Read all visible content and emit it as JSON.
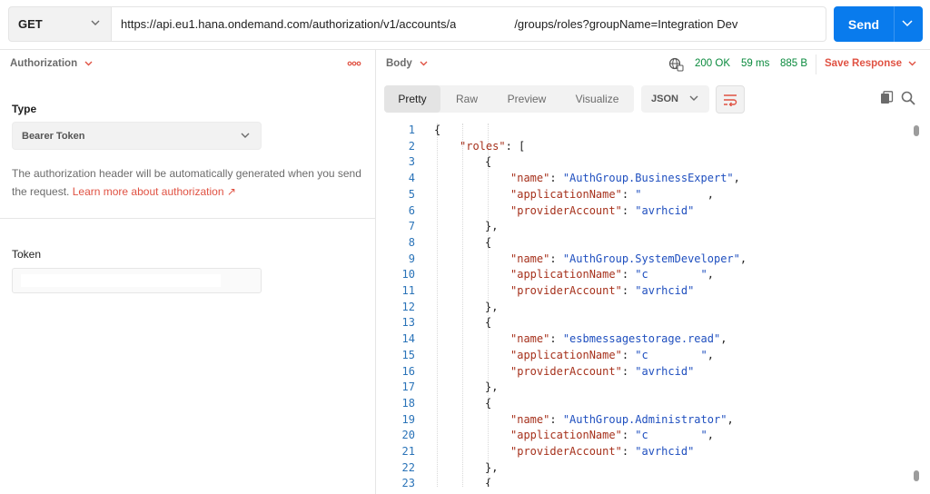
{
  "request": {
    "method": "GET",
    "url_before": "https://api.eu1.hana.ondemand.com/authorization/v1/accounts/a",
    "url_after": "/groups/roles?groupName=Integration Dev",
    "send_label": "Send"
  },
  "left": {
    "tab_title": "Authorization",
    "type_label": "Type",
    "type_value": "Bearer Token",
    "description": "The authorization header will be automatically generated when you send the request.",
    "learn_more": "Learn more about authorization ↗",
    "token_label": "Token"
  },
  "right": {
    "tab_title": "Body",
    "status": "200 OK",
    "time": "59 ms",
    "size": "885 B",
    "save_label": "Save Response",
    "tabs": [
      "Pretty",
      "Raw",
      "Preview",
      "Visualize"
    ],
    "format": "JSON"
  },
  "code_lines": [
    {
      "n": "1",
      "indent": 0,
      "parts": [
        [
          "p",
          "{"
        ]
      ]
    },
    {
      "n": "2",
      "indent": 1,
      "parts": [
        [
          "k",
          "\"roles\""
        ],
        [
          "p",
          ": ["
        ]
      ]
    },
    {
      "n": "3",
      "indent": 2,
      "parts": [
        [
          "p",
          "{"
        ]
      ]
    },
    {
      "n": "4",
      "indent": 3,
      "parts": [
        [
          "k",
          "\"name\""
        ],
        [
          "p",
          ": "
        ],
        [
          "s",
          "\"AuthGroup.BusinessExpert\""
        ],
        [
          "p",
          ","
        ]
      ]
    },
    {
      "n": "5",
      "indent": 3,
      "parts": [
        [
          "k",
          "\"applicationName\""
        ],
        [
          "p",
          ": "
        ],
        [
          "s",
          "\""
        ],
        [
          "p",
          "          ,"
        ]
      ]
    },
    {
      "n": "6",
      "indent": 3,
      "parts": [
        [
          "k",
          "\"providerAccount\""
        ],
        [
          "p",
          ": "
        ],
        [
          "s",
          "\"avrhcid\""
        ]
      ]
    },
    {
      "n": "7",
      "indent": 2,
      "parts": [
        [
          "p",
          "},"
        ]
      ]
    },
    {
      "n": "8",
      "indent": 2,
      "parts": [
        [
          "p",
          "{"
        ]
      ]
    },
    {
      "n": "9",
      "indent": 3,
      "parts": [
        [
          "k",
          "\"name\""
        ],
        [
          "p",
          ": "
        ],
        [
          "s",
          "\"AuthGroup.SystemDeveloper\""
        ],
        [
          "p",
          ","
        ]
      ]
    },
    {
      "n": "10",
      "indent": 3,
      "parts": [
        [
          "k",
          "\"applicationName\""
        ],
        [
          "p",
          ": "
        ],
        [
          "s",
          "\"c        \""
        ],
        [
          "p",
          ","
        ]
      ]
    },
    {
      "n": "11",
      "indent": 3,
      "parts": [
        [
          "k",
          "\"providerAccount\""
        ],
        [
          "p",
          ": "
        ],
        [
          "s",
          "\"avrhcid\""
        ]
      ]
    },
    {
      "n": "12",
      "indent": 2,
      "parts": [
        [
          "p",
          "},"
        ]
      ]
    },
    {
      "n": "13",
      "indent": 2,
      "parts": [
        [
          "p",
          "{"
        ]
      ]
    },
    {
      "n": "14",
      "indent": 3,
      "parts": [
        [
          "k",
          "\"name\""
        ],
        [
          "p",
          ": "
        ],
        [
          "s",
          "\"esbmessagestorage.read\""
        ],
        [
          "p",
          ","
        ]
      ]
    },
    {
      "n": "15",
      "indent": 3,
      "parts": [
        [
          "k",
          "\"applicationName\""
        ],
        [
          "p",
          ": "
        ],
        [
          "s",
          "\"c        \""
        ],
        [
          "p",
          ","
        ]
      ]
    },
    {
      "n": "16",
      "indent": 3,
      "parts": [
        [
          "k",
          "\"providerAccount\""
        ],
        [
          "p",
          ": "
        ],
        [
          "s",
          "\"avrhcid\""
        ]
      ]
    },
    {
      "n": "17",
      "indent": 2,
      "parts": [
        [
          "p",
          "},"
        ]
      ]
    },
    {
      "n": "18",
      "indent": 2,
      "parts": [
        [
          "p",
          "{"
        ]
      ]
    },
    {
      "n": "19",
      "indent": 3,
      "parts": [
        [
          "k",
          "\"name\""
        ],
        [
          "p",
          ": "
        ],
        [
          "s",
          "\"AuthGroup.Administrator\""
        ],
        [
          "p",
          ","
        ]
      ]
    },
    {
      "n": "20",
      "indent": 3,
      "parts": [
        [
          "k",
          "\"applicationName\""
        ],
        [
          "p",
          ": "
        ],
        [
          "s",
          "\"c        \""
        ],
        [
          "p",
          ","
        ]
      ]
    },
    {
      "n": "21",
      "indent": 3,
      "parts": [
        [
          "k",
          "\"providerAccount\""
        ],
        [
          "p",
          ": "
        ],
        [
          "s",
          "\"avrhcid\""
        ]
      ]
    },
    {
      "n": "22",
      "indent": 2,
      "parts": [
        [
          "p",
          "},"
        ]
      ]
    },
    {
      "n": "23",
      "indent": 2,
      "parts": [
        [
          "p",
          "{"
        ]
      ]
    }
  ]
}
